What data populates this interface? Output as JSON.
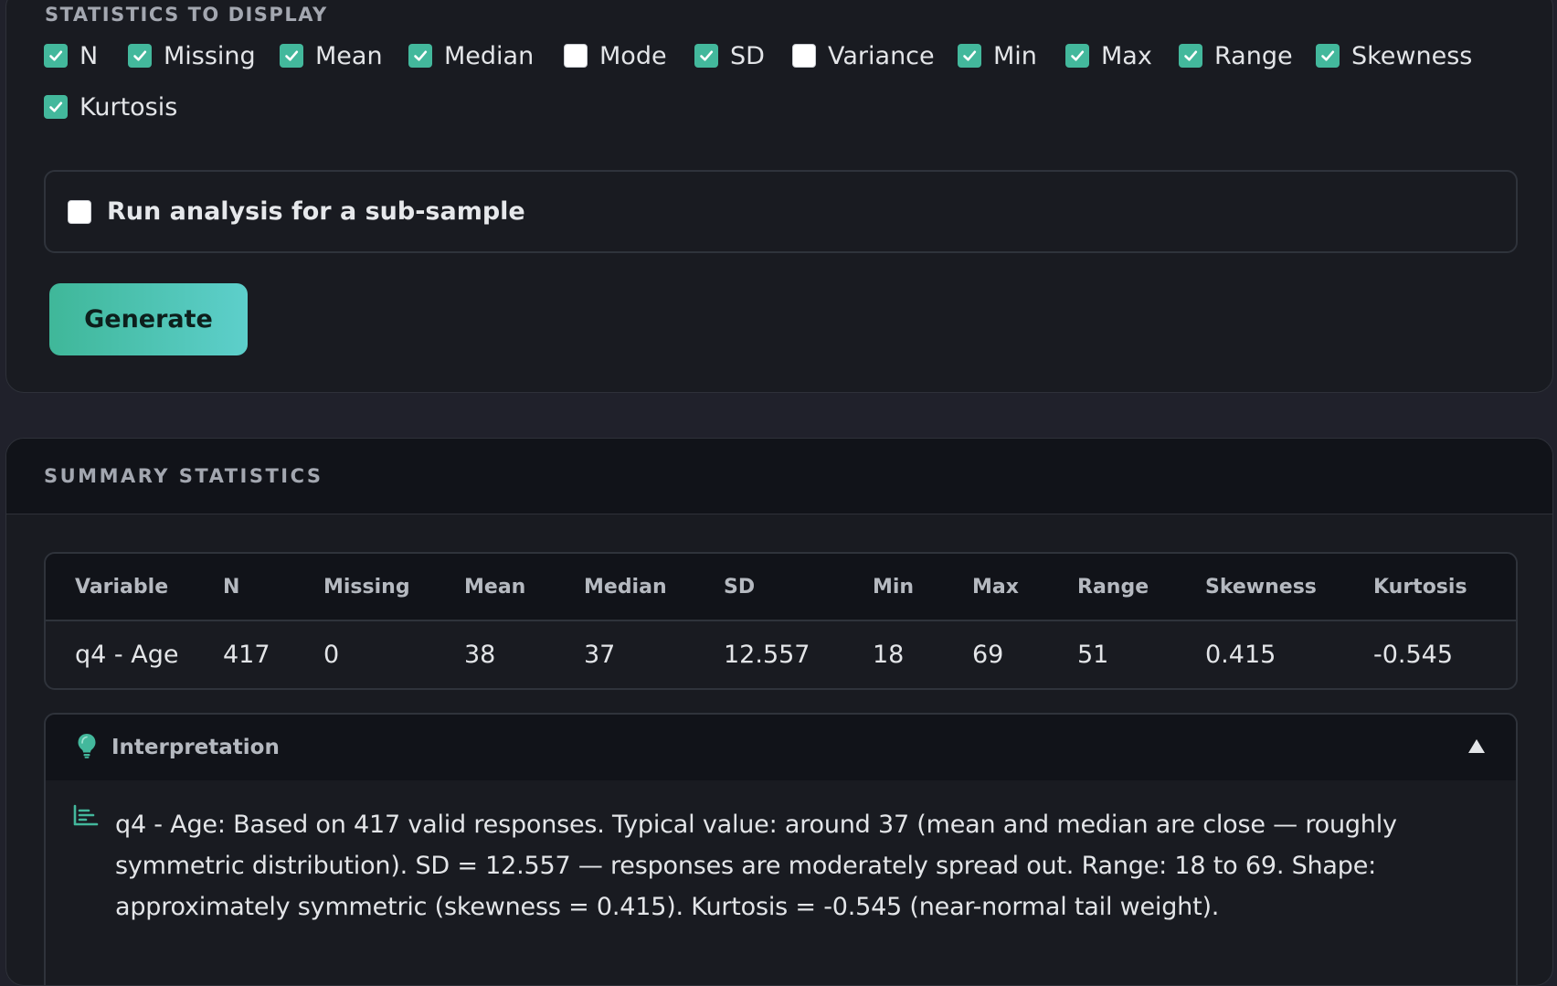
{
  "statistics_panel": {
    "section_label": "STATISTICS TO DISPLAY",
    "options": [
      {
        "label": "N",
        "checked": true
      },
      {
        "label": "Missing",
        "checked": true
      },
      {
        "label": "Mean",
        "checked": true
      },
      {
        "label": "Median",
        "checked": true
      },
      {
        "label": "Mode",
        "checked": false
      },
      {
        "label": "SD",
        "checked": true
      },
      {
        "label": "Variance",
        "checked": false
      },
      {
        "label": "Min",
        "checked": true
      },
      {
        "label": "Max",
        "checked": true
      },
      {
        "label": "Range",
        "checked": true
      },
      {
        "label": "Skewness",
        "checked": true
      },
      {
        "label": "Kurtosis",
        "checked": true
      }
    ],
    "subsample": {
      "label": "Run analysis for a sub-sample",
      "checked": false
    },
    "generate_label": "Generate"
  },
  "summary": {
    "section_label": "SUMMARY STATISTICS",
    "table": {
      "columns": [
        "Variable",
        "N",
        "Missing",
        "Mean",
        "Median",
        "SD",
        "Min",
        "Max",
        "Range",
        "Skewness",
        "Kurtosis"
      ],
      "rows": [
        [
          "q4 - Age",
          "417",
          "0",
          "38",
          "37",
          "12.557",
          "18",
          "69",
          "51",
          "0.415",
          "-0.545"
        ]
      ]
    },
    "interpretation": {
      "title": "Interpretation",
      "expanded": true,
      "text": "q4 - Age: Based on 417 valid responses. Typical value: around 37 (mean and median are close — roughly symmetric distribution). SD = 12.557 — responses are moderately spread out. Range: 18 to 69. Shape: approximately symmetric (skewness = 0.415). Kurtosis = -0.545 (near-normal tail weight)."
    }
  },
  "colors": {
    "accent": "#43b89c",
    "background": "#20212b",
    "card": "#191b21",
    "header": "#111319"
  },
  "icons": {
    "check": "check-icon",
    "interpretation": "lightbulb-icon",
    "collapse": "triangle-up-icon",
    "text_block": "list-icon"
  }
}
